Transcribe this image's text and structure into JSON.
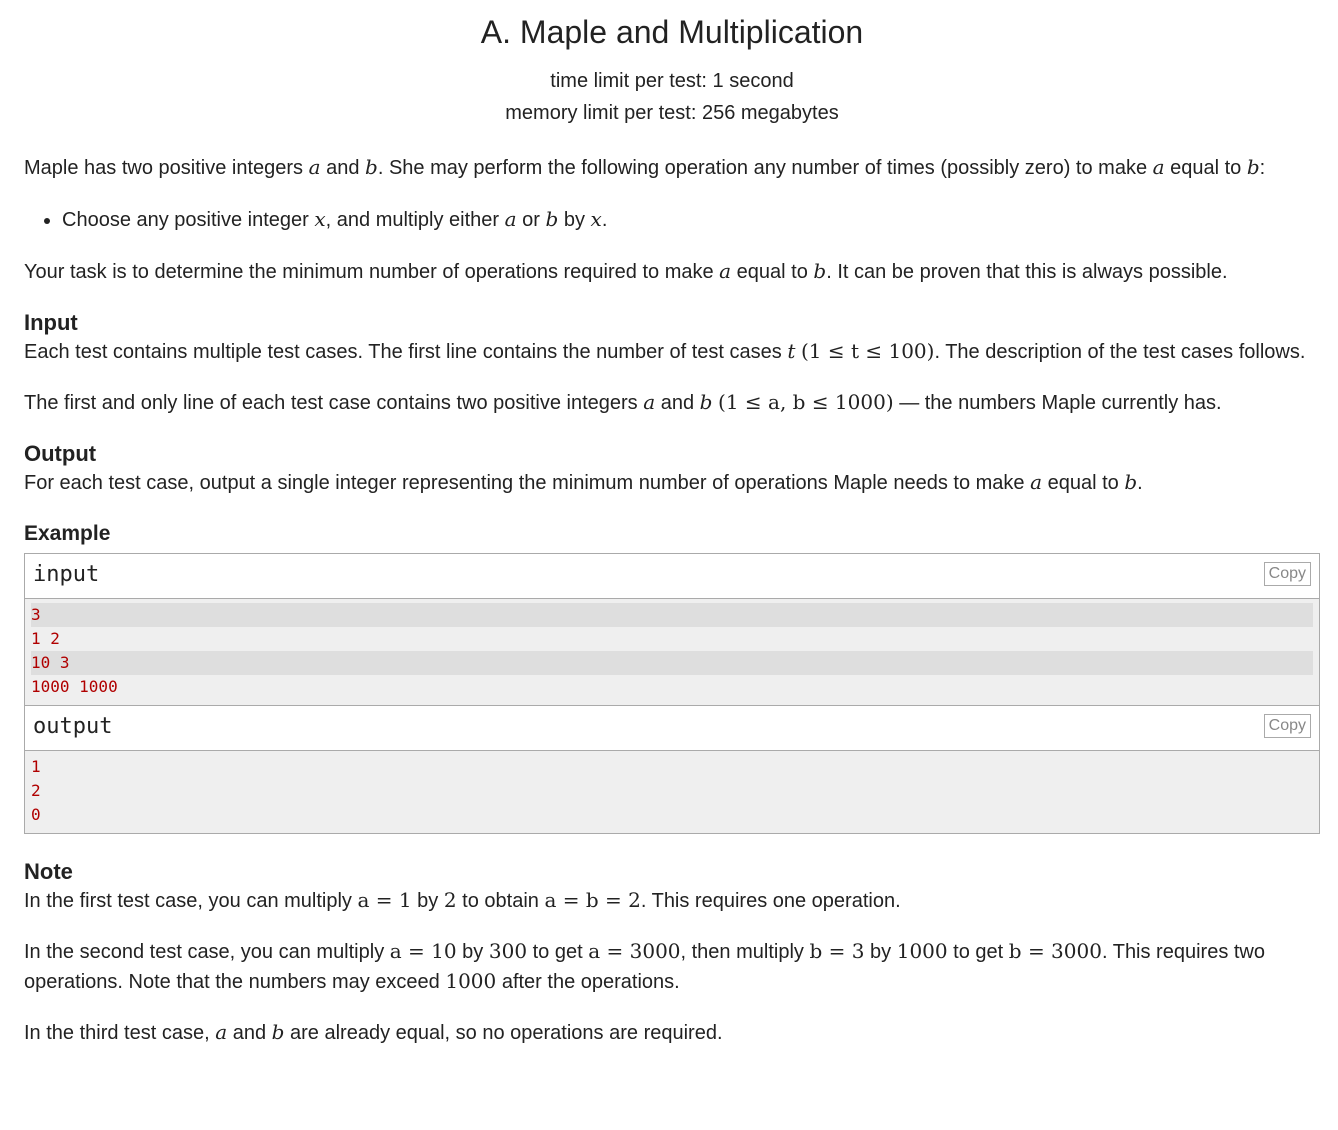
{
  "header": {
    "title": "A. Maple and Multiplication",
    "time_limit": "time limit per test: 1 second",
    "memory_limit": "memory limit per test: 256 megabytes"
  },
  "statement": {
    "p1_a": "Maple has two positive integers ",
    "p1_b": " and ",
    "p1_c": ". She may perform the following operation any number of times (possibly zero) to make ",
    "p1_d": " equal to ",
    "p1_e": ":",
    "bullet_a": "Choose any positive integer ",
    "bullet_b": ", and multiply either ",
    "bullet_c": " or ",
    "bullet_d": " by ",
    "bullet_e": ".",
    "task_a": "Your task is to determine the minimum number of operations required to make ",
    "task_b": " equal to ",
    "task_c": ". It can be proven that this is always possible."
  },
  "vars": {
    "a": "a",
    "b": "b",
    "x": "x",
    "t": "t"
  },
  "input_section": {
    "title": "Input",
    "p1_a": "Each test contains multiple test cases. The first line contains the number of test cases ",
    "p1_math": "(1 ≤ t ≤ 100)",
    "p1_b": ". The description of the test cases follows.",
    "p2_a": "The first and only line of each test case contains two positive integers ",
    "p2_b": " and ",
    "p2_math": "(1 ≤ a, b ≤ 1000)",
    "p2_c": " — the numbers Maple currently has."
  },
  "output_section": {
    "title": "Output",
    "p1_a": "For each test case, output a single integer representing the minimum number of operations Maple needs to make ",
    "p1_b": " equal to ",
    "p1_c": "."
  },
  "example": {
    "title": "Example",
    "input_label": "input",
    "output_label": "output",
    "copy_label": "Copy",
    "input_lines": [
      "3",
      "1 2",
      "10 3",
      "1000 1000"
    ],
    "output_lines": [
      "1",
      "2",
      "0"
    ]
  },
  "note": {
    "title": "Note",
    "p1_a": "In the first test case, you can multiply ",
    "p1_m1": "a = 1",
    "p1_b": " by ",
    "p1_m2": "2",
    "p1_c": " to obtain ",
    "p1_m3": "a = b = 2",
    "p1_d": ". This requires one operation.",
    "p2_a": "In the second test case, you can multiply ",
    "p2_m1": "a = 10",
    "p2_b": " by ",
    "p2_m2": "300",
    "p2_c": " to get ",
    "p2_m3": "a = 3000",
    "p2_d": ", then multiply ",
    "p2_m4": "b = 3",
    "p2_e": " by ",
    "p2_m5": "1000",
    "p2_f": " to get ",
    "p2_m6": "b = 3000",
    "p2_g": ". This requires two operations. Note that the numbers may exceed ",
    "p2_m7": "1000",
    "p2_h": " after the operations.",
    "p3_a": "In the third test case, ",
    "p3_b": " and ",
    "p3_c": " are already equal, so no operations are required."
  }
}
